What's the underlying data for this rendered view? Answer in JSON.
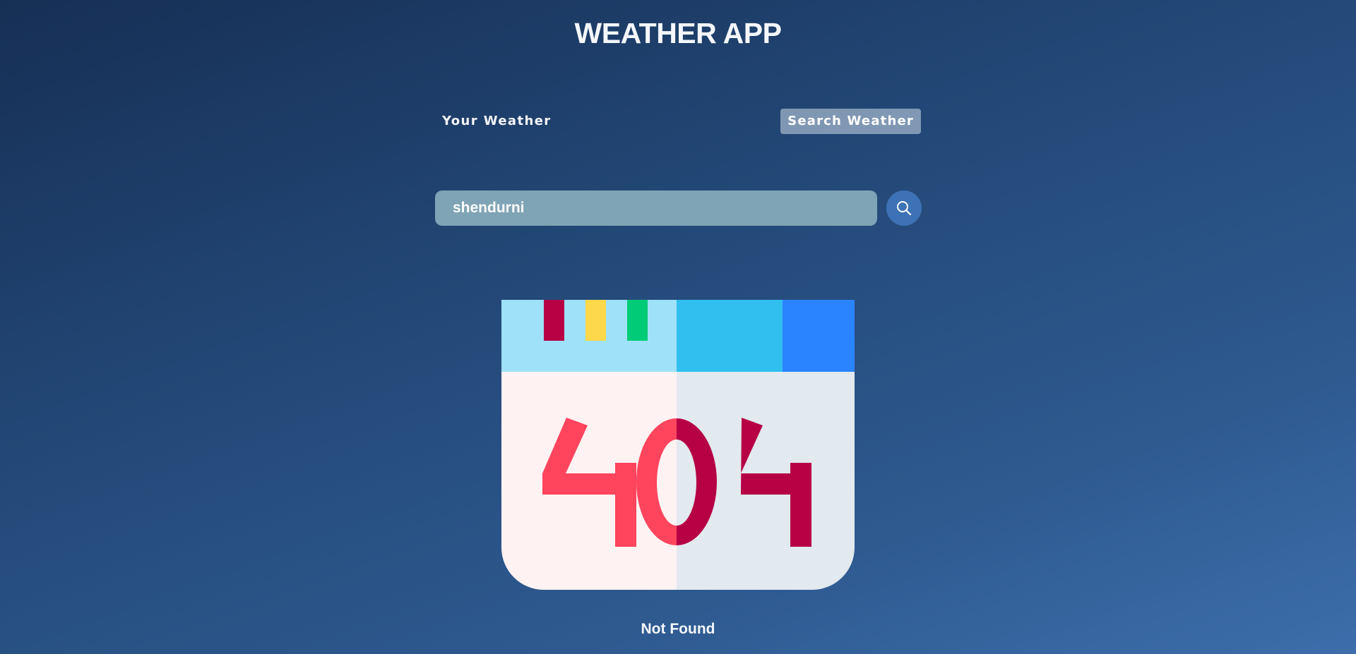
{
  "app": {
    "title": "WEATHER APP"
  },
  "tabs": {
    "your_weather": "Your Weather",
    "search_weather": "Search Weather",
    "active": "Search Weather"
  },
  "search": {
    "value": "shendurni",
    "button_icon": "search-icon"
  },
  "result": {
    "illustration_icon": "404-error-icon",
    "illustration_text": "404",
    "status": "Not Found"
  },
  "colors": {
    "background_start": "#162f55",
    "background_end": "#3d6eab",
    "search_field": "#7fa4b5",
    "search_button": "#3d72b6",
    "active_tab": "#a7b9cf",
    "error_red": "#ff445e",
    "error_dark_red": "#b60245"
  }
}
